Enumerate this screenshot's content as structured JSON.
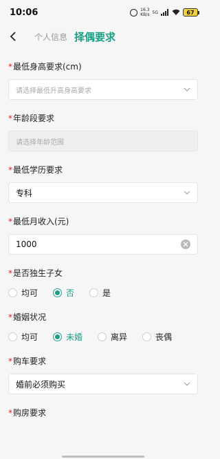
{
  "status": {
    "time": "10:06",
    "speed_value": "16.3",
    "speed_unit": "KB/s",
    "network": "5G",
    "battery": "67"
  },
  "nav": {
    "tab_inactive": "个人信息",
    "tab_active": "择偶要求"
  },
  "fields": {
    "height": {
      "label": "最低身高要求(cm)",
      "placeholder": "请选择最低升高身高要求"
    },
    "age": {
      "label": "年龄段要求",
      "placeholder": "请选择年龄范围"
    },
    "education": {
      "label": "最低学历要求",
      "value": "专科"
    },
    "income": {
      "label": "最低月收入(元)",
      "value": "1000"
    },
    "only_child": {
      "label": "是否独生子女",
      "options": [
        "均可",
        "否",
        "是"
      ],
      "selected": "否"
    },
    "marital": {
      "label": "婚姻状况",
      "options": [
        "均可",
        "未婚",
        "离异",
        "丧偶"
      ],
      "selected": "未婚"
    },
    "car": {
      "label": "购车要求",
      "value": "婚前必须购买"
    },
    "house": {
      "label": "购房要求"
    }
  },
  "colors": {
    "accent": "#1a9e86",
    "required": "#e02020"
  }
}
